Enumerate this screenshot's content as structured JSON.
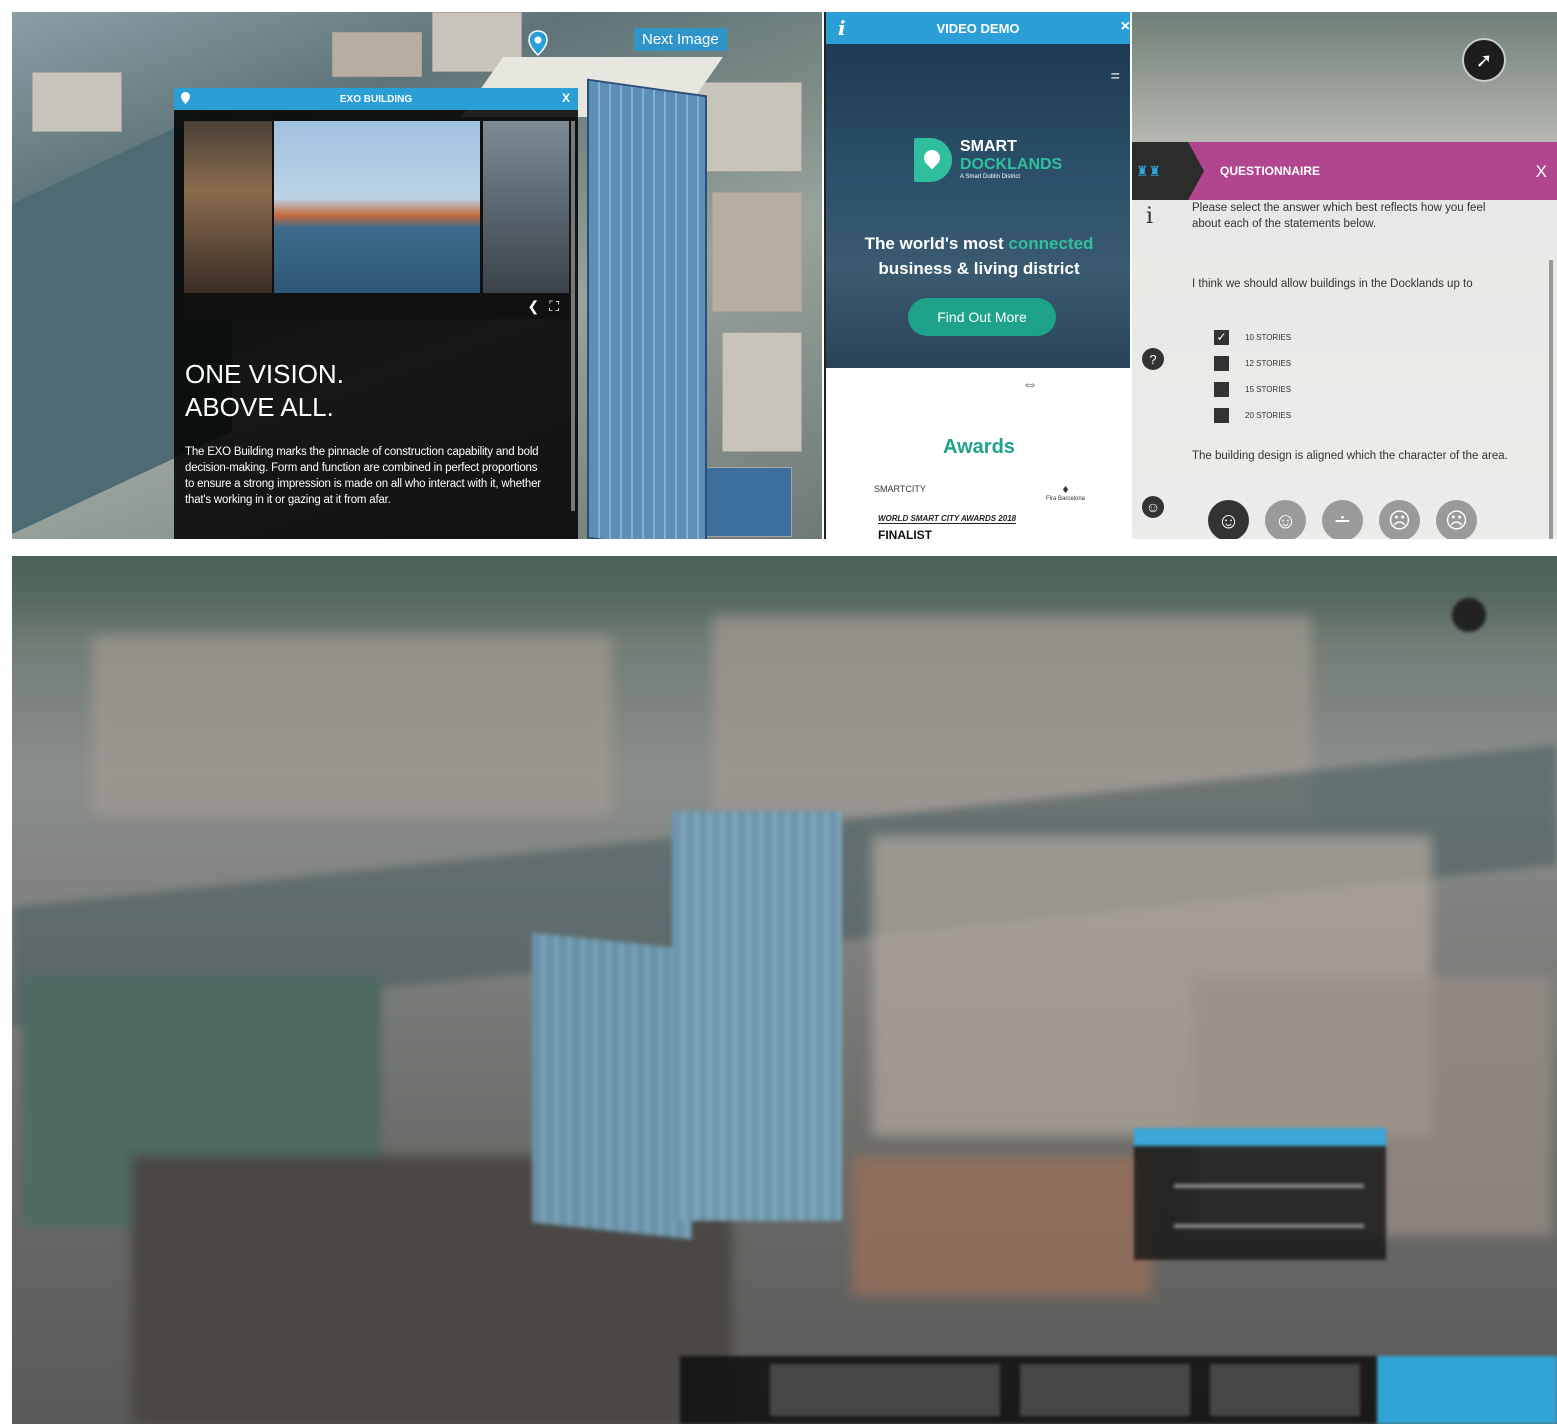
{
  "map_panel": {
    "next_image_label": "Next Image",
    "exo_window": {
      "title": "EXO BUILDING",
      "close": "X",
      "heading_line1": "ONE VISION.",
      "heading_line2": "ABOVE ALL.",
      "body": "The EXO Building marks the pinnacle of construction capability and bold decision-making. Form and function are combined in perfect proportions to ensure a strong impression is made on all who interact with it, whether that's working in it or gazing at it from afar.",
      "gallery_controls": {
        "prev": "❮",
        "fullscreen": "⛶"
      }
    }
  },
  "video_panel": {
    "title": "VIDEO DEMO",
    "info": "i",
    "close": "×",
    "menu": "=",
    "logo_line1": "SMART",
    "logo_line2": "DOCKLANDS",
    "logo_sub": "A Smart Dublin District",
    "hero_line1_a": "The world's most ",
    "hero_line1_b": "connected",
    "hero_line2": "business & living district",
    "cta": "Find Out More",
    "awards_heading": "Awards",
    "smartcity_logo": "SMARTCITY",
    "fira_logo": "Fira Barcelona",
    "award_line": "WORLD SMART CITY AWARDS 2018",
    "award_finalist": "FINALIST"
  },
  "questionnaire": {
    "title": "QUESTIONNAIRE",
    "close": "X",
    "intro": "Please select the answer which best reflects how you feel about each of the statements below.",
    "question1": "I think we should allow buildings in the Docklands up to",
    "options": [
      {
        "label": "10 STORIES",
        "checked": true
      },
      {
        "label": "12 STORIES",
        "checked": false
      },
      {
        "label": "15 STORIES",
        "checked": false
      },
      {
        "label": "20 STORIES",
        "checked": false
      }
    ],
    "question2": "The building design is aligned which the character of the area.",
    "rating_selected_index": 0
  },
  "colors": {
    "accent_blue": "#2a9fd6",
    "accent_teal": "#1ea38a",
    "questionnaire_magenta": "#b1468e"
  }
}
